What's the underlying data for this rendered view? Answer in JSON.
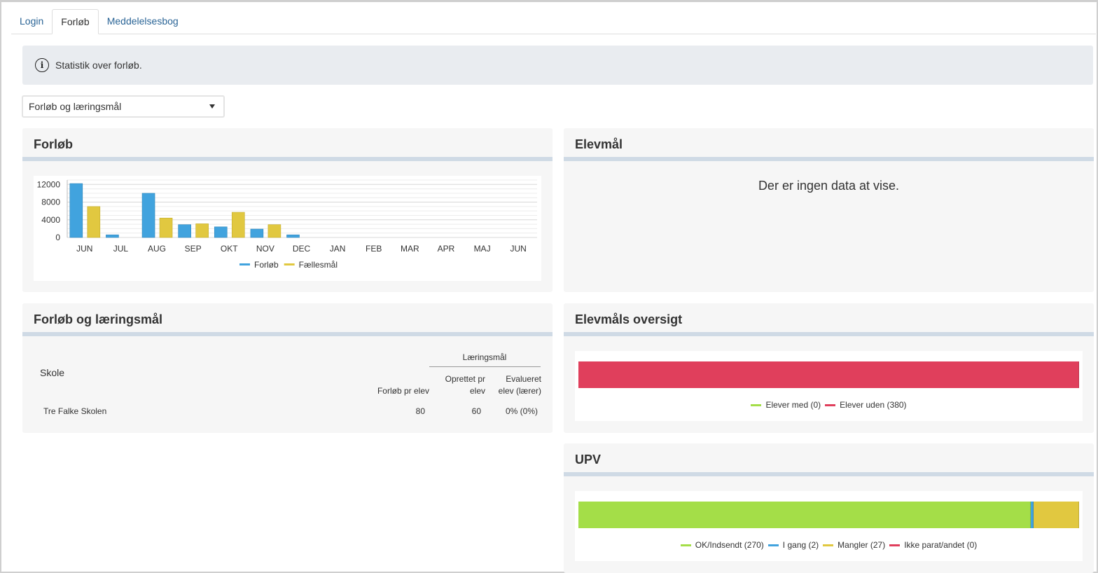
{
  "tabs": [
    {
      "label": "Login"
    },
    {
      "label": "Forløb"
    },
    {
      "label": "Meddelelsesbog"
    }
  ],
  "info": {
    "text": "Statistik over forløb."
  },
  "select": {
    "value": "Forløb og læringsmål"
  },
  "panels": {
    "forlob": {
      "title": "Forløb"
    },
    "elevmal": {
      "title": "Elevmål",
      "nodata": "Der er ingen data at vise."
    },
    "forlob_laering": {
      "title": "Forløb og læringsmål"
    },
    "elevmal_oversigt": {
      "title": "Elevmåls oversigt"
    },
    "upv": {
      "title": "UPV"
    }
  },
  "table": {
    "group_header": "Læringsmål",
    "col_school": "Skole",
    "col_forlob": "Forløb pr elev",
    "col_oprettet_1": "Oprettet pr",
    "col_oprettet_2": "elev",
    "col_evalueret_1": "Evalueret",
    "col_evalueret_2": "elev (lærer)",
    "rows": [
      {
        "school": "Tre Falke Skolen",
        "forlob": "80",
        "oprettet": "60",
        "evalueret": "0% (0%)"
      }
    ]
  },
  "colors": {
    "blue": "#41a3de",
    "yellow": "#e1c840",
    "green": "#a4de48",
    "red": "#e03f5c"
  },
  "chart_data": [
    {
      "type": "bar",
      "categories": [
        "JUN",
        "JUL",
        "AUG",
        "SEP",
        "OKT",
        "NOV",
        "DEC",
        "JAN",
        "FEB",
        "MAR",
        "APR",
        "MAJ",
        "JUN"
      ],
      "series": [
        {
          "name": "Forløb",
          "color": "#41a3de",
          "values": [
            12200,
            600,
            10000,
            2900,
            2400,
            1900,
            600,
            0,
            0,
            0,
            0,
            0,
            0
          ]
        },
        {
          "name": "Fællesmål",
          "color": "#e1c840",
          "values": [
            7000,
            0,
            4400,
            3100,
            5700,
            2900,
            0,
            0,
            0,
            0,
            0,
            0,
            0
          ]
        }
      ],
      "yticks": [
        0,
        4000,
        8000,
        12000
      ],
      "ylim": [
        0,
        13000
      ],
      "grid": true,
      "legend": "bottom"
    },
    {
      "type": "bar",
      "orientation": "horizontal-stacked",
      "series": [
        {
          "name": "Elever med (0)",
          "color": "#a4de48",
          "value": 0
        },
        {
          "name": "Elever uden (380)",
          "color": "#e03f5c",
          "value": 380
        }
      ],
      "legend": "bottom"
    },
    {
      "type": "bar",
      "orientation": "horizontal-stacked",
      "series": [
        {
          "name": "OK/Indsendt (270)",
          "color": "#a4de48",
          "value": 270
        },
        {
          "name": "I gang (2)",
          "color": "#41a3de",
          "value": 2
        },
        {
          "name": "Mangler (27)",
          "color": "#e1c840",
          "value": 27
        },
        {
          "name": "Ikke parat/andet (0)",
          "color": "#e03f5c",
          "value": 0
        }
      ],
      "legend": "bottom"
    }
  ]
}
